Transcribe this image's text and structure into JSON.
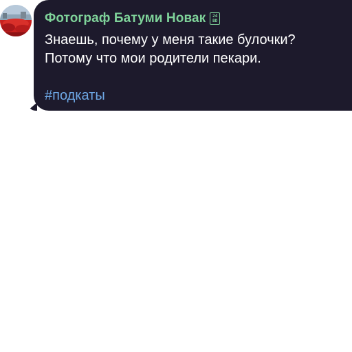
{
  "message": {
    "sender_name": "Фотограф Батуми Новак",
    "sender_badge": "24\nBD",
    "sender_badge_icon": "admin-badge-icon",
    "sender_color": "#7fd39a",
    "text": "Знаешь, почему у меня такие булочки?\nПотому что мои родители пекари.",
    "hashtag": "#подкаты",
    "hashtag_color": "#6ea8e6",
    "bubble_color": "#1d1a2c"
  },
  "avatar": {
    "icon": "user-avatar-photo"
  }
}
